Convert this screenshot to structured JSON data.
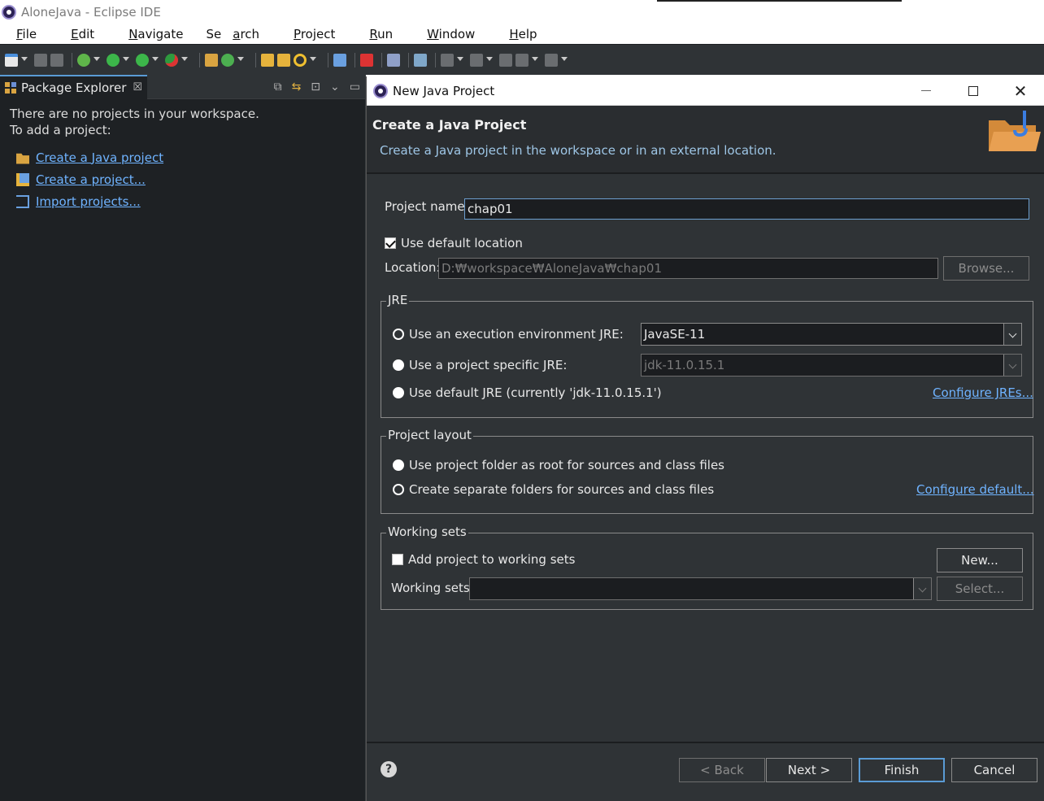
{
  "window": {
    "title": "AloneJava - Eclipse IDE"
  },
  "menu": {
    "items": [
      {
        "pre": "",
        "u": "F",
        "post": "ile"
      },
      {
        "pre": "",
        "u": "E",
        "post": "dit"
      },
      {
        "pre": "",
        "u": "N",
        "post": "avigate"
      },
      {
        "pre": "Se",
        "u": "a",
        "post": "rch"
      },
      {
        "pre": "",
        "u": "P",
        "post": "roject"
      },
      {
        "pre": "",
        "u": "R",
        "post": "un"
      },
      {
        "pre": "",
        "u": "W",
        "post": "indow"
      },
      {
        "pre": "",
        "u": "H",
        "post": "elp"
      }
    ]
  },
  "package_explorer": {
    "tab_label": "Package Explorer",
    "close_glyph": "☒",
    "message_line1": "There are no projects in your workspace.",
    "message_line2": "To add a project:",
    "links": {
      "create_java": "Create a Java project",
      "create_project": "Create a project...",
      "import": "Import projects..."
    }
  },
  "dialog": {
    "title": "New Java Project",
    "header_title": "Create a Java Project",
    "header_desc": "Create a Java project in the workspace or in an external location.",
    "project_name_label": "Project name:",
    "project_name_value": "chap01",
    "use_default_location": "Use default location",
    "location_label": "Location:",
    "location_value": "D:₩workspace₩AloneJava₩chap01",
    "browse_label": "Browse...",
    "jre": {
      "group_label": "JRE",
      "exec_env_label": "Use an execution environment JRE:",
      "exec_env_value": "JavaSE-11",
      "project_specific_label": "Use a project specific JRE:",
      "project_specific_value": "jdk-11.0.15.1",
      "default_label": "Use default JRE (currently 'jdk-11.0.15.1')",
      "configure_link": "Configure JREs..."
    },
    "layout": {
      "group_label": "Project layout",
      "option_root": "Use project folder as root for sources and class files",
      "option_separate": "Create separate folders for sources and class files",
      "configure_link": "Configure default..."
    },
    "working_sets": {
      "group_label": "Working sets",
      "add_label": "Add project to working sets",
      "new_button": "New...",
      "sets_label": "Working sets:",
      "select_button": "Select..."
    },
    "buttons": {
      "back": "< Back",
      "next": "Next >",
      "finish": "Finish",
      "cancel": "Cancel"
    },
    "help_glyph": "?"
  },
  "colors": {
    "link": "#6fb3ff",
    "dialog_bg": "#2f3336",
    "panel_bg": "#1e2124",
    "focus_border": "#5a9bd5"
  }
}
